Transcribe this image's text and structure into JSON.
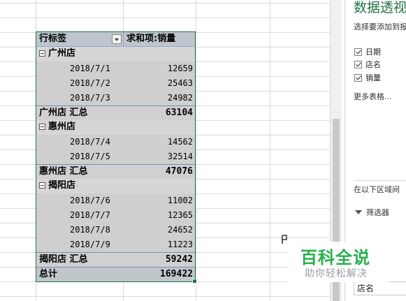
{
  "pivot": {
    "header": {
      "row_labels": "行标签",
      "value_field": "求和项:销量"
    },
    "groups": [
      {
        "name": "广州店",
        "items": [
          {
            "date": "2018/7/1",
            "value": "12659"
          },
          {
            "date": "2018/7/2",
            "value": "25463"
          },
          {
            "date": "2018/7/3",
            "value": "24982"
          }
        ],
        "subtotal_label": "广州店 汇总",
        "subtotal": "63104"
      },
      {
        "name": "惠州店",
        "items": [
          {
            "date": "2018/7/4",
            "value": "14562"
          },
          {
            "date": "2018/7/5",
            "value": "32514"
          }
        ],
        "subtotal_label": "惠州店 汇总",
        "subtotal": "47076"
      },
      {
        "name": "揭阳店",
        "items": [
          {
            "date": "2018/7/6",
            "value": "11002"
          },
          {
            "date": "2018/7/7",
            "value": "12365"
          },
          {
            "date": "2018/7/8",
            "value": "24652"
          },
          {
            "date": "2018/7/9",
            "value": "11223"
          }
        ],
        "subtotal_label": "揭阳店 汇总",
        "subtotal": "59242"
      }
    ],
    "grand_total_label": "总计",
    "grand_total": "169422"
  },
  "field_pane": {
    "title": "数据透视",
    "hint": "选择要添加到报",
    "fields": [
      {
        "label": "日期",
        "checked": true
      },
      {
        "label": "店名",
        "checked": true
      },
      {
        "label": "销量",
        "checked": true
      }
    ],
    "more_tables": "更多表格...",
    "areas_hint": "在以下区域间",
    "filter_label": "筛选器",
    "row_area_item": "店名"
  },
  "watermark": {
    "title": "百科全说",
    "subtitle": "助你轻松解决"
  },
  "colors": {
    "accent": "#217346",
    "watermark_green": "#27b04a"
  }
}
